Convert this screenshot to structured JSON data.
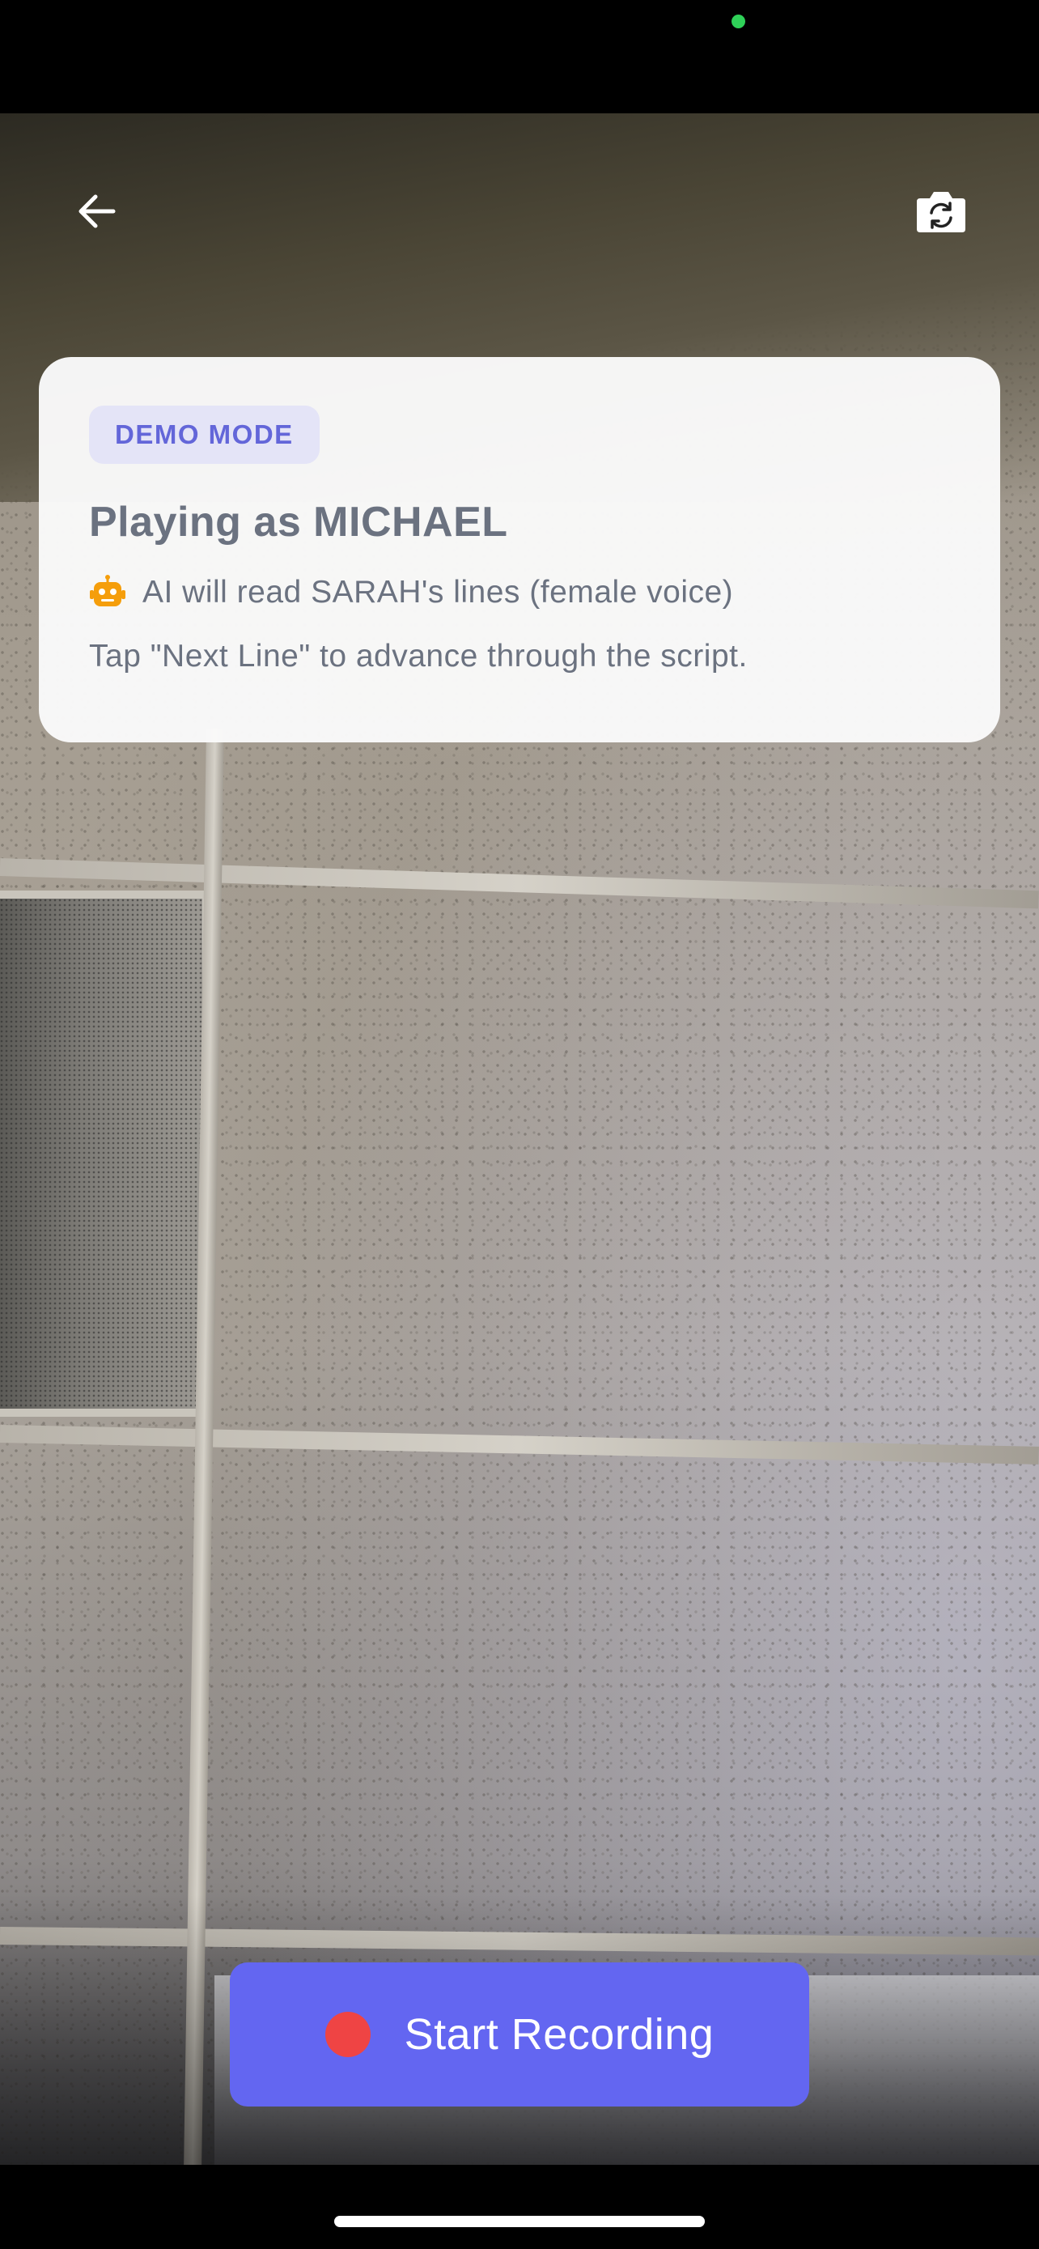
{
  "header": {
    "back_icon": "arrow-left-icon",
    "flip_camera_icon": "camera-flip-icon"
  },
  "card": {
    "badge": "DEMO MODE",
    "title": "Playing as MICHAEL",
    "ai_icon": "robot-icon",
    "ai_line": "AI will read SARAH's lines (female voice)",
    "hint": "Tap \"Next Line\" to advance through the script."
  },
  "record": {
    "label": "Start Recording",
    "icon": "record-dot-icon"
  },
  "colors": {
    "accent": "#6366f1",
    "badge_bg": "#e4e4f7",
    "badge_text": "#6366d9",
    "record_dot": "#ef4444",
    "robot": "#f59e0b",
    "status_dot": "#2fd158"
  }
}
